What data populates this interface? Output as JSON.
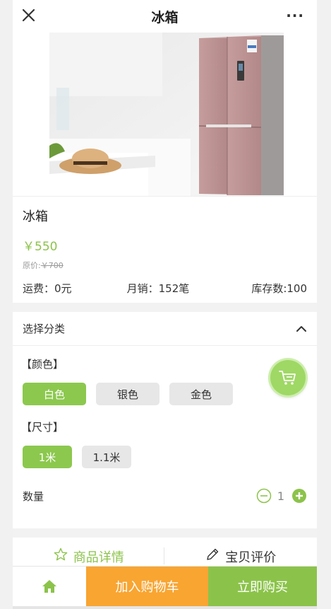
{
  "header": {
    "title": "冰箱",
    "close_icon": "close-icon",
    "more_label": "···"
  },
  "product": {
    "name": "冰箱",
    "price": "￥550",
    "original_price_label": "原价:",
    "original_price": "￥700",
    "shipping": "运费：0元",
    "monthly_sales": "月销：152笔",
    "stock": "库存数:100"
  },
  "spec": {
    "title": "选择分类",
    "color_label": "【颜色】",
    "colors": [
      "白色",
      "银色",
      "金色"
    ],
    "selected_color": "白色",
    "size_label": "【尺寸】",
    "sizes": [
      "1米",
      "1.1米"
    ],
    "selected_size": "1米",
    "quantity_label": "数量",
    "quantity": "1"
  },
  "tabs": {
    "details": "商品详情",
    "reviews": "宝贝评价"
  },
  "bottom_bar": {
    "add_to_cart": "加入购物车",
    "buy_now": "立即购买"
  },
  "colors": {
    "accent_green": "#8bc34a",
    "orange": "#f8a532"
  }
}
